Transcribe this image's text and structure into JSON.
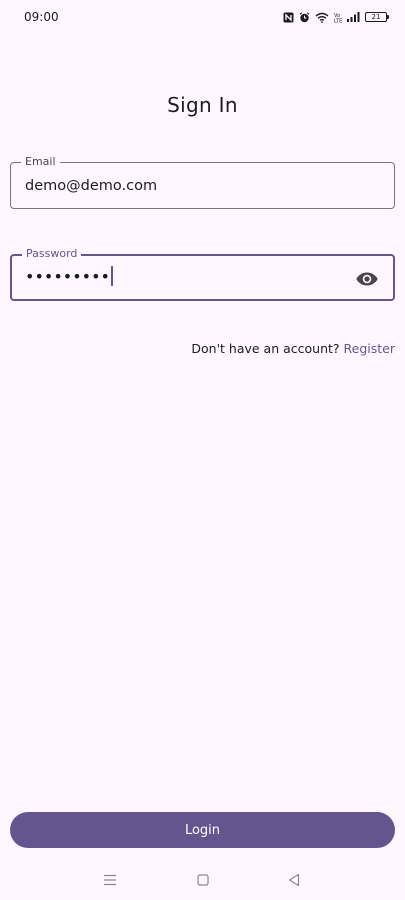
{
  "status_bar": {
    "time": "09:00",
    "battery_level": "21",
    "icons": [
      "nfc-icon",
      "alarm-icon",
      "wifi-icon",
      "volte-icon",
      "signal-icon",
      "battery-icon"
    ]
  },
  "page": {
    "title": "Sign In"
  },
  "email_field": {
    "label": "Email",
    "value": "demo@demo.com"
  },
  "password_field": {
    "label": "Password",
    "masked_value": "•••••••••",
    "visibility_icon": "eye-icon"
  },
  "register": {
    "prompt": "Don't have an account?",
    "link_label": "Register"
  },
  "login_button": {
    "label": "Login"
  },
  "nav_bar": {
    "icons": [
      "menu-icon",
      "home-icon",
      "back-icon"
    ]
  },
  "colors": {
    "background": "#FEF7FF",
    "primary": "#65558F",
    "on_primary": "#FFFFFF",
    "outline": "#79747E",
    "text": "#1D1B20"
  }
}
